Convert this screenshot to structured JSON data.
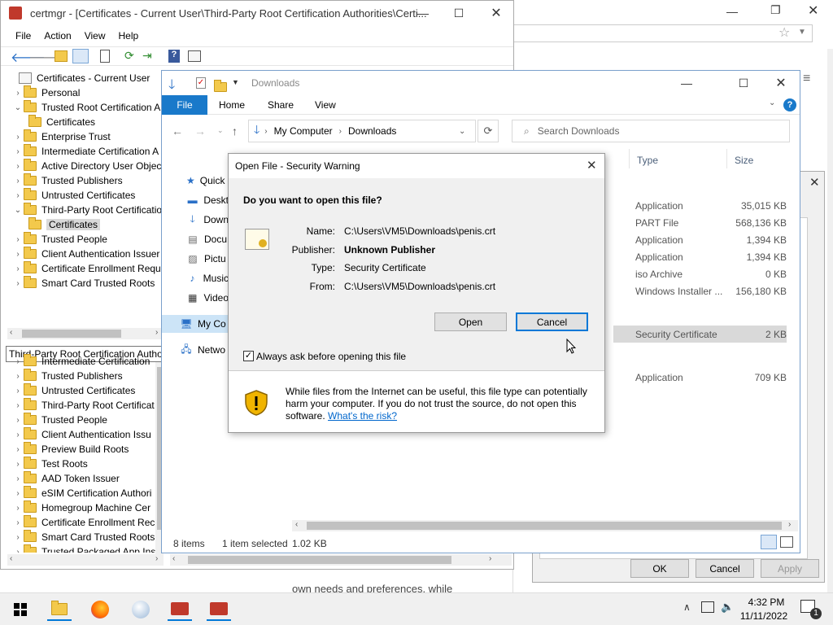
{
  "browser_bg": {
    "partial_text": "own needs and preferences. while"
  },
  "certmgr": {
    "title": "certmgr - [Certificates - Current User\\Third-Party Root Certification Authorities\\Certi...",
    "menu": [
      "File",
      "Action",
      "View",
      "Help"
    ],
    "tree_top": [
      {
        "label": "Certificates - Current User",
        "indent": 0,
        "chev": "",
        "icon": "certmgr-icon"
      },
      {
        "label": "Personal",
        "indent": 1,
        "chev": ">"
      },
      {
        "label": "Trusted Root Certification A",
        "indent": 1,
        "chev": "v"
      },
      {
        "label": "Certificates",
        "indent": 2,
        "chev": ""
      },
      {
        "label": "Enterprise Trust",
        "indent": 1,
        "chev": ">"
      },
      {
        "label": "Intermediate Certification A",
        "indent": 1,
        "chev": ">"
      },
      {
        "label": "Active Directory User Object",
        "indent": 1,
        "chev": ">"
      },
      {
        "label": "Trusted Publishers",
        "indent": 1,
        "chev": ">"
      },
      {
        "label": "Untrusted Certificates",
        "indent": 1,
        "chev": ">"
      },
      {
        "label": "Third-Party Root Certificatio",
        "indent": 1,
        "chev": "v"
      },
      {
        "label": "Certificates",
        "indent": 2,
        "chev": "",
        "selected": true
      },
      {
        "label": "Trusted People",
        "indent": 1,
        "chev": ">"
      },
      {
        "label": "Client Authentication Issuer",
        "indent": 1,
        "chev": ">"
      },
      {
        "label": "Certificate Enrollment Requ",
        "indent": 1,
        "chev": ">"
      },
      {
        "label": "Smart Card Trusted Roots",
        "indent": 1,
        "chev": ">"
      }
    ],
    "status": "Third-Party Root Certification Autho",
    "tree_bottom": [
      {
        "label": "Intermediate Certification",
        "chev": ">"
      },
      {
        "label": "Trusted Publishers",
        "chev": ">"
      },
      {
        "label": "Untrusted Certificates",
        "chev": ">"
      },
      {
        "label": "Third-Party Root Certificat",
        "chev": ">"
      },
      {
        "label": "Trusted People",
        "chev": ">"
      },
      {
        "label": "Client Authentication Issu",
        "chev": ">"
      },
      {
        "label": "Preview Build Roots",
        "chev": ">"
      },
      {
        "label": "Test Roots",
        "chev": ">"
      },
      {
        "label": "AAD Token Issuer",
        "chev": ">"
      },
      {
        "label": "eSIM Certification Authori",
        "chev": ">"
      },
      {
        "label": "Homegroup Machine Cer",
        "chev": ">"
      },
      {
        "label": "Certificate Enrollment Rec",
        "chev": ">"
      },
      {
        "label": "Smart Card Trusted Roots",
        "chev": ">"
      },
      {
        "label": "Trusted Packaged App Ins",
        "chev": ">"
      }
    ]
  },
  "explorer": {
    "title": "Downloads",
    "ribbon_tabs": [
      "File",
      "Home",
      "Share",
      "View"
    ],
    "path": [
      "My Computer",
      "Downloads"
    ],
    "search_placeholder": "Search Downloads",
    "columns": {
      "type": "Type",
      "size": "Size"
    },
    "nav": [
      {
        "label": "Quick a",
        "icon": "star-icon"
      },
      {
        "label": "Deskt",
        "icon": "desktop-icon"
      },
      {
        "label": "Down",
        "icon": "download-icon"
      },
      {
        "label": "Docu",
        "icon": "document-icon"
      },
      {
        "label": "Pictu",
        "icon": "picture-icon"
      },
      {
        "label": "Music",
        "icon": "music-icon"
      },
      {
        "label": "Video",
        "icon": "video-icon"
      },
      {
        "label": "My Co",
        "icon": "computer-icon",
        "selected": true
      },
      {
        "label": "Netwo",
        "icon": "network-icon"
      }
    ],
    "files": [
      {
        "type": "Application",
        "size": "35,015 KB"
      },
      {
        "type": "PART File",
        "size": "568,136 KB"
      },
      {
        "type": "Application",
        "size": "1,394 KB"
      },
      {
        "type": "Application",
        "size": "1,394 KB"
      },
      {
        "type": "iso Archive",
        "size": "0 KB"
      },
      {
        "type": "Windows Installer ...",
        "size": "156,180 KB"
      },
      {
        "type": "Security Certificate",
        "size": "2 KB",
        "selected": true
      },
      {
        "type": "Application",
        "size": "709 KB"
      }
    ],
    "status": {
      "items": "8 items",
      "selected": "1 item selected",
      "size": "1.02 KB"
    }
  },
  "dialog": {
    "title": "Open File - Security Warning",
    "question": "Do you want to open this file?",
    "name_label": "Name:",
    "name_value": "C:\\Users\\VM5\\Downloads\\penis.crt",
    "publisher_label": "Publisher:",
    "publisher_value": "Unknown Publisher",
    "type_label": "Type:",
    "type_value": "Security Certificate",
    "from_label": "From:",
    "from_value": "C:\\Users\\VM5\\Downloads\\penis.crt",
    "open_label": "Open",
    "cancel_label": "Cancel",
    "checkbox_label": "Always ask before opening this file",
    "checkbox_checked": true,
    "warning_text": "While files from the Internet can be useful, this file type can potentially harm your computer. If you do not trust the source, do not open this software.",
    "risk_link": "What's the risk?"
  },
  "props_dialog": {
    "ok_label": "OK",
    "cancel_label": "Cancel",
    "apply_label": "Apply"
  },
  "taskbar": {
    "time": "4:32 PM",
    "date": "11/11/2022",
    "notification_count": "1"
  }
}
